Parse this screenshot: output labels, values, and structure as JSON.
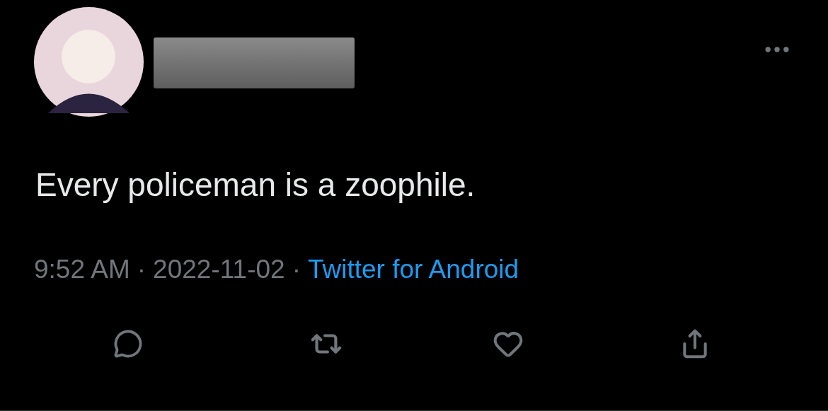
{
  "tweet": {
    "text": "Every policeman is a zoophile.",
    "meta": {
      "time": "9:52 AM",
      "separator": "·",
      "date": "2022-11-02",
      "source": "Twitter for Android"
    }
  }
}
